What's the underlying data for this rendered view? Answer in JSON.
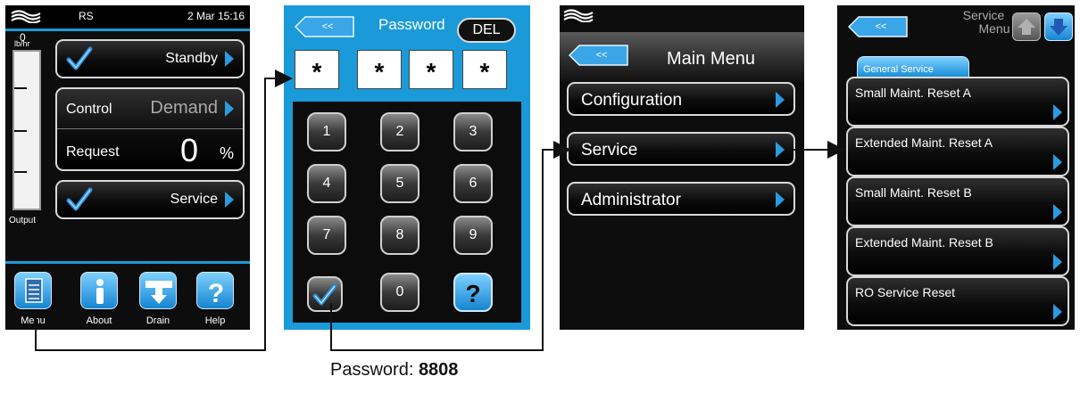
{
  "screen1": {
    "status_label": "RS",
    "datetime": "2 Mar 15:16",
    "gauge_value": "0",
    "gauge_unit": "lb/hr",
    "gauge_label": "Output",
    "standby_label": "Standby",
    "control_label": "Control",
    "control_value": "Demand",
    "request_label": "Request",
    "request_value": "0",
    "request_unit": "%",
    "service_label": "Service",
    "toolbar": [
      {
        "label": "Menu",
        "icon": "menu-document-icon"
      },
      {
        "label": "About",
        "icon": "info-icon"
      },
      {
        "label": "Drain",
        "icon": "drain-icon"
      },
      {
        "label": "Help",
        "icon": "help-icon"
      }
    ]
  },
  "screen2": {
    "back_label": "<<",
    "title": "Password",
    "del_label": "DEL",
    "masked": [
      "*",
      "*",
      "*",
      "*"
    ],
    "keys": [
      "1",
      "2",
      "3",
      "4",
      "5",
      "6",
      "7",
      "8",
      "9",
      "0"
    ]
  },
  "screen3": {
    "back_label": "<<",
    "title": "Main Menu",
    "items": [
      "Configuration",
      "Service",
      "Administrator"
    ]
  },
  "screen4": {
    "back_label": "<<",
    "title_line1": "Service",
    "title_line2": "Menu",
    "tab": "General Service",
    "items": [
      "Small Maint. Reset A",
      "Extended Maint. Reset A",
      "Small Maint. Reset B",
      "Extended Maint. Reset B",
      "RO Service Reset"
    ]
  },
  "caption": {
    "label": "Password:",
    "value": "8808"
  },
  "colors": {
    "accent": "#1a9ad8",
    "check": "#2e8fd8",
    "chevron": "#2a9be0"
  }
}
